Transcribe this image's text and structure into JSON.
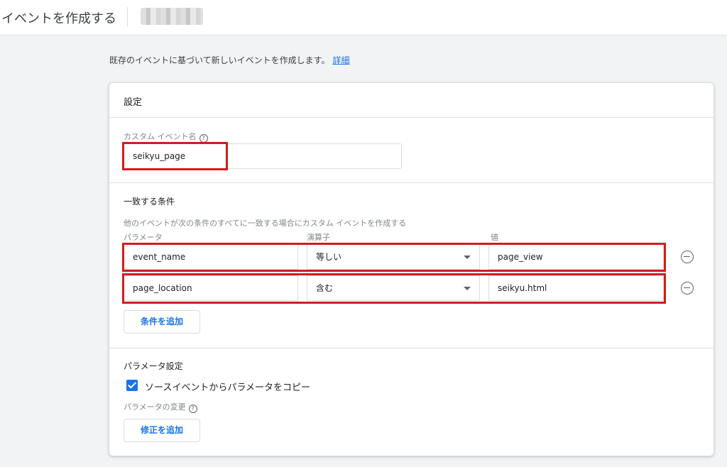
{
  "header": {
    "title": "イベントを作成する"
  },
  "intro": {
    "text": "既存のイベントに基づいて新しいイベントを作成します。",
    "link": "詳細"
  },
  "settings": {
    "section_title": "設定",
    "custom_event_label": "カスタム イベント名",
    "custom_event_value": "seikyu_page"
  },
  "matching": {
    "title": "一致する条件",
    "description": "他のイベントが次の条件のすべてに一致する場合にカスタム イベントを作成する",
    "col_param": "パラメータ",
    "col_operator": "演算子",
    "col_value": "値",
    "conditions": [
      {
        "param": "event_name",
        "operator": "等しい",
        "value": "page_view"
      },
      {
        "param": "page_location",
        "operator": "含む",
        "value": "seikyu.html"
      }
    ],
    "add_button": "条件を追加"
  },
  "param_settings": {
    "title": "パラメータ設定",
    "copy_checkbox_label": "ソースイベントからパラメータをコピー",
    "copy_checked": true,
    "modify_label": "パラメータの変更",
    "modify_button": "修正を追加"
  },
  "colors": {
    "accent": "#1a73e8",
    "highlight": "#d71920"
  }
}
